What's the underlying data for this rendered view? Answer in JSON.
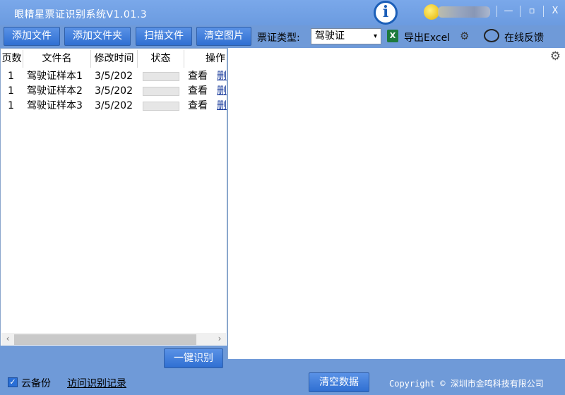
{
  "window": {
    "title": "眼精星票证识别系统V1.01.3",
    "logo_char": "i",
    "controls": {
      "minimize": "—",
      "restore": "▫",
      "close": "X"
    }
  },
  "toolbar": {
    "add_file": "添加文件",
    "add_folder": "添加文件夹",
    "scan_file": "扫描文件",
    "clear_images": "清空图片",
    "type_label": "票证类型:",
    "type_selected": "驾驶证",
    "export_excel": "导出Excel",
    "feedback": "在线反馈"
  },
  "table": {
    "columns": [
      "页数",
      "文件名",
      "修改时间",
      "状态",
      "操作"
    ],
    "rows": [
      {
        "page": "1",
        "name": "驾驶证样本1",
        "modified": "3/5/202",
        "progress": 0,
        "view": "查看",
        "delete": "删"
      },
      {
        "page": "1",
        "name": "驾驶证样本2",
        "modified": "3/5/202",
        "progress": 0,
        "view": "查看",
        "delete": "删"
      },
      {
        "page": "1",
        "name": "驾驶证样本3",
        "modified": "3/5/202",
        "progress": 0,
        "view": "查看",
        "delete": "删"
      }
    ]
  },
  "actions": {
    "recognize": "一键识别"
  },
  "statusbar": {
    "cloud_backup_checked": true,
    "cloud_backup": "云备份",
    "history_link": "访问识别记录",
    "clear_data": "清空数据",
    "copyright": "Copyright © 深圳市金鸣科技有限公司"
  }
}
